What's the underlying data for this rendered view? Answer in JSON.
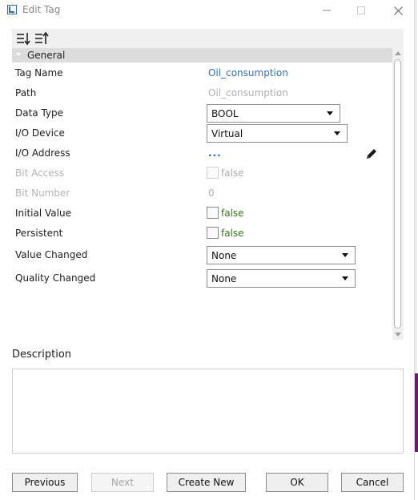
{
  "window": {
    "title": "Edit Tag",
    "accent_color": "#6b1b6e"
  },
  "toolbar": {
    "sort_categorized_icon": "sort-categorized-icon",
    "sort_alphabetical_icon": "sort-alphabetical-icon"
  },
  "category": {
    "label": "General"
  },
  "properties": {
    "tag_name": {
      "label": "Tag Name",
      "value": "Oil_consumption"
    },
    "path": {
      "label": "Path",
      "value": "Oil_consumption"
    },
    "data_type": {
      "label": "Data Type",
      "value": "BOOL"
    },
    "io_device": {
      "label": "I/O Device",
      "value": "Virtual"
    },
    "io_address": {
      "label": "I/O Address",
      "value": "..."
    },
    "bit_access": {
      "label": "Bit Access",
      "value": "false"
    },
    "bit_number": {
      "label": "Bit Number",
      "value": "0"
    },
    "initial_value": {
      "label": "Initial Value",
      "value": "false"
    },
    "persistent": {
      "label": "Persistent",
      "value": "false"
    },
    "value_changed": {
      "label": "Value Changed",
      "value": "None"
    },
    "quality_changed": {
      "label": "Quality Changed",
      "value": "None"
    }
  },
  "description": {
    "label": "Description",
    "value": ""
  },
  "buttons": {
    "previous": "Previous",
    "next": "Next",
    "create_new": "Create New",
    "ok": "OK",
    "cancel": "Cancel"
  }
}
